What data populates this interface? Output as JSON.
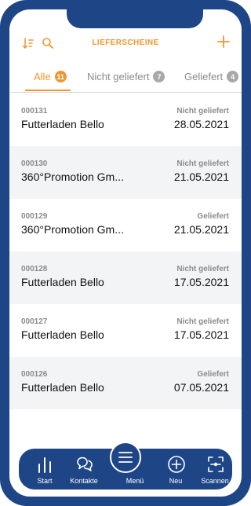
{
  "header": {
    "title": "LIEFERSCHEINE",
    "icons": [
      "sort-icon",
      "search-icon",
      "add-icon"
    ],
    "accent_color": "#f0962f"
  },
  "tabs": [
    {
      "label": "Alle",
      "count": "11",
      "active": true
    },
    {
      "label": "Nicht geliefert",
      "count": "7",
      "active": false
    },
    {
      "label": "Geliefert",
      "count": "4",
      "active": false
    }
  ],
  "rows": [
    {
      "number": "000131",
      "customer": "Futterladen Bello",
      "status": "Nicht geliefert",
      "date": "28.05.2021"
    },
    {
      "number": "000130",
      "customer": "360°Promotion Gm...",
      "status": "Nicht geliefert",
      "date": "21.05.2021"
    },
    {
      "number": "000129",
      "customer": "360°Promotion Gm...",
      "status": "Geliefert",
      "date": "21.05.2021"
    },
    {
      "number": "000128",
      "customer": "Futterladen Bello",
      "status": "Nicht geliefert",
      "date": "17.05.2021"
    },
    {
      "number": "000127",
      "customer": "Futterladen Bello",
      "status": "Nicht geliefert",
      "date": "17.05.2021"
    },
    {
      "number": "000126",
      "customer": "Futterladen Bello",
      "status": "Geliefert",
      "date": "07.05.2021"
    }
  ],
  "nav": {
    "start": "Start",
    "contacts": "Kontakte",
    "menu": "Menü",
    "new": "Neu",
    "scan": "Scannen"
  },
  "colors": {
    "frame": "#1e4687",
    "accent": "#f0962f",
    "row_alt": "#f2f4f6"
  }
}
